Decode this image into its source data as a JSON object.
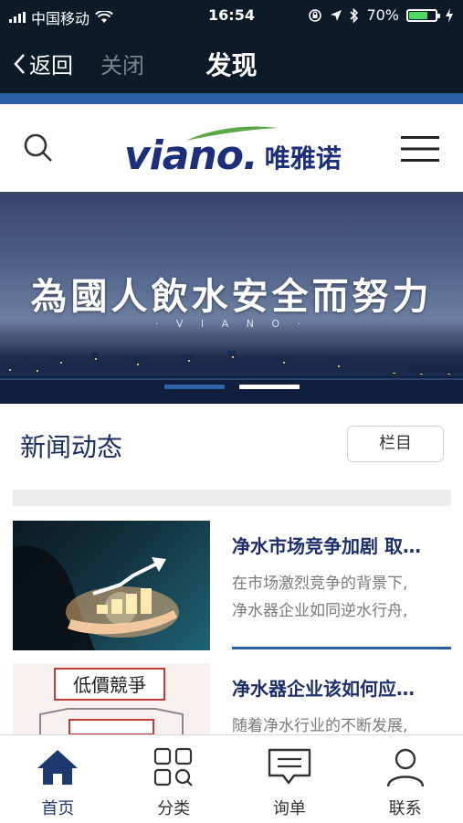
{
  "status_bar": {
    "carrier": "中国移动",
    "time": "16:54",
    "battery": "70%",
    "battery_level": 0.7
  },
  "nav": {
    "back_label": "返回",
    "close_label": "关闭",
    "title": "发现"
  },
  "header": {
    "logo_text": "viano.",
    "logo_cn": "唯雅诺"
  },
  "banner": {
    "slogan": "為國人飲水安全而努力",
    "sub": "· V I A N O ·",
    "slide_count": 2,
    "active_slide": 2
  },
  "section": {
    "title": "新闻动态",
    "category_button": "栏目"
  },
  "news": [
    {
      "headline": "净水市场竞争加剧 取…",
      "excerpt_lines": [
        "在市场激烈竞争的背景下,",
        "净水器企业如同逆水行舟,"
      ]
    },
    {
      "headline": "净水器企业该如何应…",
      "excerpt_lines": [
        "随着净水行业的不断发展,",
        ""
      ],
      "image_text": "低價競爭"
    }
  ],
  "tabbar": [
    {
      "label": "首页",
      "icon": "home-icon",
      "active": true
    },
    {
      "label": "分类",
      "icon": "grid-search-icon",
      "active": false
    },
    {
      "label": "询单",
      "icon": "message-icon",
      "active": false
    },
    {
      "label": "联系",
      "icon": "user-icon",
      "active": false
    }
  ],
  "colors": {
    "nav_bg": "#0d1a27",
    "brand_blue": "#1d2f7a",
    "accent": "#2a5ea5",
    "logo_green": "#5aa845"
  }
}
